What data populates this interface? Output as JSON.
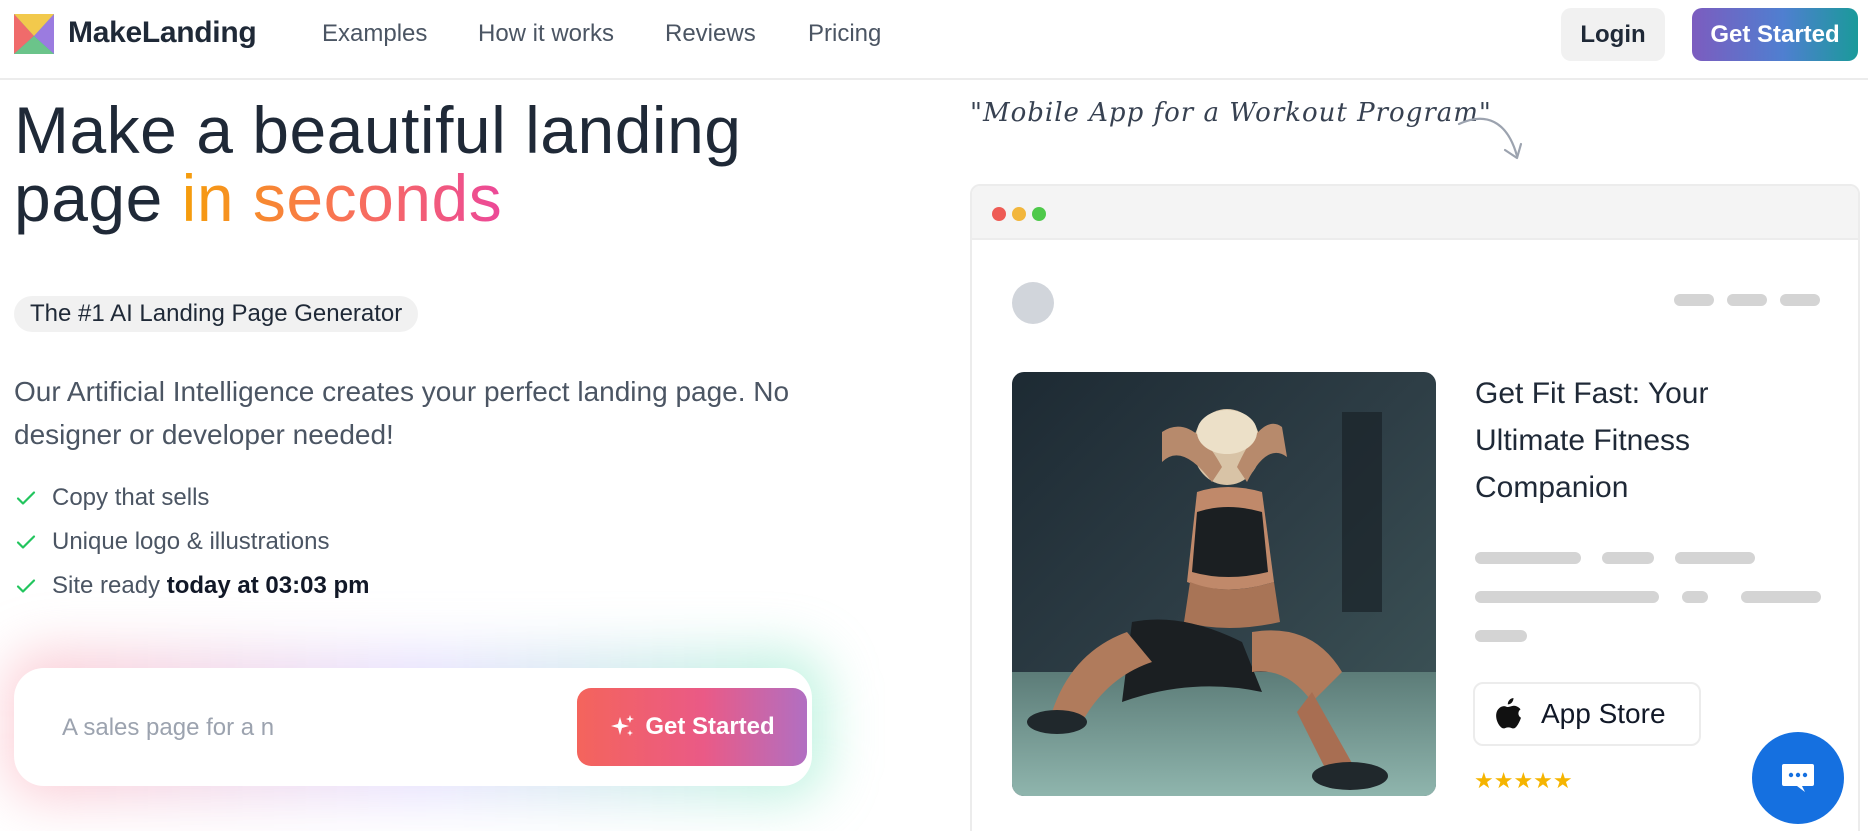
{
  "nav": {
    "brand": "MakeLanding",
    "links": [
      "Examples",
      "How it works",
      "Reviews",
      "Pricing"
    ],
    "login_label": "Login",
    "get_started_label": "Get Started"
  },
  "hero": {
    "title_part1": "Make a beautiful landing page ",
    "title_highlight": "in seconds",
    "tagline": "The #1 AI Landing Page Generator",
    "description": "Our Artificial Intelligence creates your perfect landing page. No designer or developer needed!",
    "features": [
      {
        "text": "Copy that sells"
      },
      {
        "text": "Unique logo & illustrations"
      },
      {
        "text": "Site ready ",
        "strong": "today at 03:03 pm"
      }
    ],
    "input_value": "A sales page for a n",
    "cta_label": "Get Started"
  },
  "preview": {
    "note": "\"Mobile App for a Workout Program\"",
    "heading": "Get Fit Fast: Your Ultimate Fitness Companion",
    "app_store_label": "App Store",
    "stars": "★★★★★"
  },
  "colors": {
    "accent_gradient_start": "#7c5cbf",
    "accent_gradient_end": "#1a9a9a",
    "highlight_start": "#f59e0b",
    "highlight_end": "#ec4899",
    "check_green": "#22c55e",
    "chat_blue": "#1570e0",
    "star_yellow": "#f5b400"
  },
  "icons": [
    "makelanding-logo-icon",
    "check-icon",
    "sparkle-icon",
    "curved-arrow-icon",
    "apple-icon",
    "chat-icon"
  ]
}
